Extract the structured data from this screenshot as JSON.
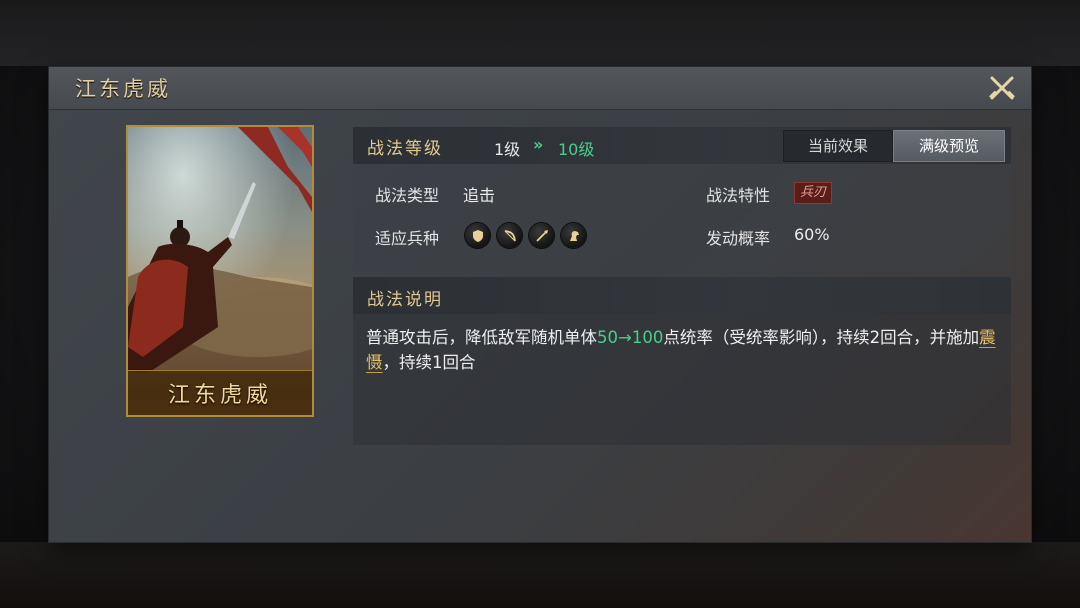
{
  "dialog": {
    "title": "江东虎威",
    "close_icon": "close-crossed-swords-icon"
  },
  "card": {
    "name": "江东虎威"
  },
  "level": {
    "label": "战法等级",
    "current": "1级",
    "arrow": "»",
    "max": "10级"
  },
  "tabs": {
    "current_effect": "当前效果",
    "max_preview": "满级预览",
    "selected": "满级预览"
  },
  "type": {
    "label": "战法类型",
    "value": "追击"
  },
  "trait": {
    "label": "战法特性",
    "value": "兵刃"
  },
  "units": {
    "label": "适应兵种",
    "icons": [
      "shield-icon",
      "bow-icon",
      "spear-icon",
      "horse-icon"
    ]
  },
  "rate": {
    "label": "发动概率",
    "value": "60%"
  },
  "description": {
    "title": "战法说明",
    "part1": "普通攻击后，降低敌军随机单体",
    "range": "50→100",
    "part2": "点统率（受统率影响），持续2回合，并施加",
    "link": "震慑",
    "part3": "，持续1回合"
  },
  "colors": {
    "gold": "#e0c990",
    "green": "#46d08a",
    "trait_bg": "#5a1e1a"
  }
}
